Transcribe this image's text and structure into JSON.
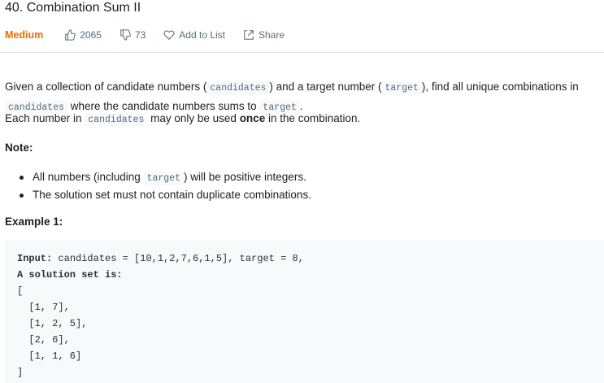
{
  "problem": {
    "title": "40. Combination Sum II",
    "difficulty": "Medium",
    "likes": "2065",
    "dislikes": "73",
    "add_to_list": "Add to List",
    "share": "Share"
  },
  "description": {
    "p1_a": "Given a collection of candidate numbers (",
    "p1_code1": "candidates",
    "p1_b": ") and a target number (",
    "p1_code2": "target",
    "p1_c": "), find all unique combinations in",
    "p1_code3": "candidates",
    "p1_d": "where the candidate numbers sums to",
    "p1_code4": "target",
    "p1_e": ".",
    "p2_a": "Each number in",
    "p2_code": "candidates",
    "p2_b": "may only be used",
    "p2_bold": "once",
    "p2_c": "in the combination.",
    "note_title": "Note:",
    "note_1a": "All numbers (including",
    "note_1code": "target",
    "note_1b": ") will be positive integers.",
    "note_2": "The solution set must not contain duplicate combinations.",
    "example_title": "Example 1:"
  },
  "example": {
    "input_label": "Input:",
    "input_value": " candidates = [10,1,2,7,6,1,5], target = 8,",
    "solution_label": "A solution set is:",
    "lines": [
      "[",
      "  [1, 7],",
      "  [1, 2, 5],",
      "  [2, 6],",
      "  [1, 1, 6]",
      "]"
    ]
  },
  "icons": [
    "thumbs-up-icon",
    "thumbs-down-icon",
    "heart-icon",
    "share-icon"
  ],
  "colors": {
    "difficulty": "#ef6c00",
    "muted": "#546e7a",
    "code_bg": "#f7f9fa"
  }
}
